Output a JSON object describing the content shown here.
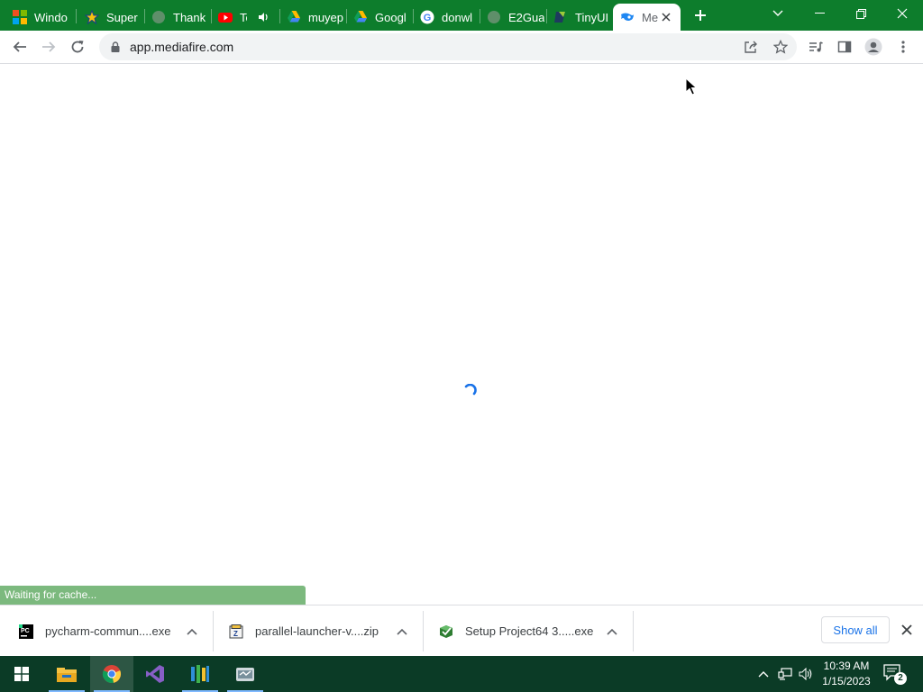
{
  "browser": {
    "tabs": [
      {
        "title": "Windo",
        "icon": "windows-icon"
      },
      {
        "title": "Super",
        "icon": "star-icon"
      },
      {
        "title": "Thank",
        "icon": "globe-icon"
      },
      {
        "title": "Tes",
        "icon": "youtube-icon"
      },
      {
        "title": "muyep",
        "icon": "google-drive-icon"
      },
      {
        "title": "Googl",
        "icon": "google-drive-icon"
      },
      {
        "title": "donwl",
        "icon": "google-icon"
      },
      {
        "title": "E2Gua",
        "icon": "globe-icon"
      },
      {
        "title": "TinyUI",
        "icon": "tinyui-icon"
      },
      {
        "title": "Me",
        "icon": "mediafire-icon",
        "active": true
      }
    ],
    "address_bar": {
      "url": "app.mediafire.com"
    }
  },
  "status_bubble": {
    "text": "Waiting for cache..."
  },
  "downloads": {
    "items": [
      {
        "filename": "pycharm-commun....exe",
        "icon": "pycharm-icon"
      },
      {
        "filename": "parallel-launcher-v....zip",
        "icon": "zip-icon"
      },
      {
        "filename": "Setup Project64 3.....exe",
        "icon": "installer-icon"
      }
    ],
    "show_all_label": "Show all"
  },
  "taskbar": {
    "apps": [
      "start-icon",
      "file-explorer-icon",
      "chrome-icon",
      "visual-studio-icon",
      "app-icon",
      "app2-icon"
    ],
    "clock": {
      "time": "10:39 AM",
      "date": "1/15/2023"
    },
    "notification_count": "2"
  },
  "colors": {
    "tabstrip": "#0d7d2c",
    "status_bubble": "#7cb97e",
    "taskbar": "#0b3b26",
    "accent": "#1a73e8"
  }
}
